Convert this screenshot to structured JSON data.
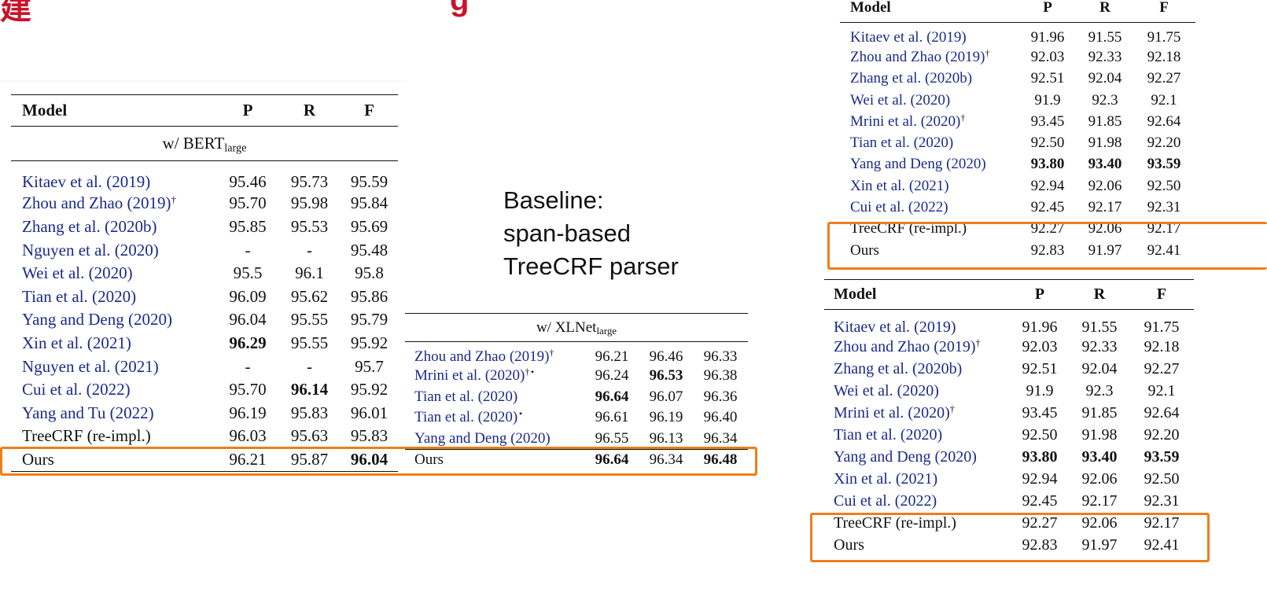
{
  "title_fragment": {
    "left": "建",
    "right": "g"
  },
  "baseline_text": [
    "Baseline:",
    "span-based",
    "TreeCRF parser"
  ],
  "headers": {
    "model": "Model",
    "p": "P",
    "r": "R",
    "f": "F"
  },
  "bert_table": {
    "section": {
      "prefix": "w/ BERT",
      "sub": "large"
    },
    "rows": [
      {
        "pre": "Kitaev et al. (",
        "year": "2019",
        "post": ")",
        "sup": "",
        "p": "95.46",
        "r": "95.73",
        "f": "95.59"
      },
      {
        "pre": "Zhou and Zhao (",
        "year": "2019",
        "post": ")",
        "sup": "†",
        "p": "95.70",
        "r": "95.98",
        "f": "95.84"
      },
      {
        "pre": "Zhang et al. (",
        "year": "2020b",
        "post": ")",
        "sup": "",
        "p": "95.85",
        "r": "95.53",
        "f": "95.69"
      },
      {
        "pre": "Nguyen et al. (",
        "year": "2020",
        "post": ")",
        "sup": "",
        "p": "-",
        "r": "-",
        "f": "95.48"
      },
      {
        "pre": "Wei et al. (",
        "year": "2020",
        "post": ")",
        "sup": "",
        "p": "95.5",
        "r": "96.1",
        "f": "95.8"
      },
      {
        "pre": "Tian et al. (",
        "year": "2020",
        "post": ")",
        "sup": "",
        "p": "96.09",
        "r": "95.62",
        "f": "95.86"
      },
      {
        "pre": "Yang and Deng (",
        "year": "2020",
        "post": ")",
        "sup": "",
        "p": "96.04",
        "r": "95.55",
        "f": "95.79"
      },
      {
        "pre": "Xin et al. (",
        "year": "2021",
        "post": ")",
        "sup": "",
        "p": "96.29",
        "r": "95.55",
        "f": "95.92",
        "bold": [
          "p"
        ]
      },
      {
        "pre": "Nguyen et al. (",
        "year": "2021",
        "post": ")",
        "sup": "",
        "p": "-",
        "r": "-",
        "f": "95.7"
      },
      {
        "pre": "Cui et al. (",
        "year": "2022",
        "post": ")",
        "sup": "",
        "p": "95.70",
        "r": "96.14",
        "f": "95.92",
        "bold": [
          "r"
        ]
      },
      {
        "pre": "Yang and Tu (",
        "year": "2022",
        "post": ")",
        "sup": "",
        "p": "96.19",
        "r": "95.83",
        "f": "96.01"
      },
      {
        "plain": "TreeCRF (re-impl.)",
        "p": "96.03",
        "r": "95.63",
        "f": "95.83"
      },
      {
        "plain": "Ours",
        "p": "96.21",
        "r": "95.87",
        "f": "96.04",
        "bold": [
          "f"
        ]
      }
    ]
  },
  "xlnet_table": {
    "section": {
      "prefix": "w/ XLNet",
      "sub": "large"
    },
    "rows": [
      {
        "pre": "Zhou and Zhao (",
        "year": "2019",
        "post": ")",
        "sup": "†",
        "p": "96.21",
        "r": "96.46",
        "f": "96.33"
      },
      {
        "pre": "Mrini et al. (",
        "year": "2020",
        "post": ")",
        "sup": "†⋆",
        "p": "96.24",
        "r": "96.53",
        "f": "96.38",
        "bold": [
          "r"
        ]
      },
      {
        "pre": "Tian et al. (",
        "year": "2020",
        "post": ")",
        "sup": "",
        "p": "96.64",
        "r": "96.07",
        "f": "96.36",
        "bold": [
          "p"
        ]
      },
      {
        "pre": "Tian et al. (",
        "year": "2020",
        "post": ")",
        "sup": "⋆",
        "p": "96.61",
        "r": "96.19",
        "f": "96.40"
      },
      {
        "pre": "Yang and Deng (",
        "year": "2020",
        "post": ")",
        "sup": "",
        "p": "96.55",
        "r": "96.13",
        "f": "96.34"
      },
      {
        "plain": "Ours",
        "p": "96.64",
        "r": "96.34",
        "f": "96.48",
        "bold": [
          "p",
          "f"
        ]
      }
    ]
  },
  "ctb_table": {
    "rows": [
      {
        "pre": "Kitaev et al. (",
        "year": "2019",
        "post": ")",
        "sup": "",
        "p": "91.96",
        "r": "91.55",
        "f": "91.75"
      },
      {
        "pre": "Zhou and Zhao (",
        "year": "2019",
        "post": ")",
        "sup": "†",
        "p": "92.03",
        "r": "92.33",
        "f": "92.18"
      },
      {
        "pre": "Zhang et al. (",
        "year": "2020b",
        "post": ")",
        "sup": "",
        "p": "92.51",
        "r": "92.04",
        "f": "92.27"
      },
      {
        "pre": "Wei et al. (",
        "year": "2020",
        "post": ")",
        "sup": "",
        "p": "91.9",
        "r": "92.3",
        "f": "92.1"
      },
      {
        "pre": "Mrini et al. (",
        "year": "2020",
        "post": ")",
        "sup": "†",
        "p": "93.45",
        "r": "91.85",
        "f": "92.64"
      },
      {
        "pre": "Tian et al. (",
        "year": "2020",
        "post": ")",
        "sup": "",
        "p": "92.50",
        "r": "91.98",
        "f": "92.20"
      },
      {
        "pre": "Yang and Deng (",
        "year": "2020",
        "post": ")",
        "sup": "",
        "p": "93.80",
        "r": "93.40",
        "f": "93.59",
        "bold": [
          "p",
          "r",
          "f"
        ]
      },
      {
        "pre": "Xin et al. (",
        "year": "2021",
        "post": ")",
        "sup": "",
        "p": "92.94",
        "r": "92.06",
        "f": "92.50"
      },
      {
        "pre": "Cui et al. (",
        "year": "2022",
        "post": ")",
        "sup": "",
        "p": "92.45",
        "r": "92.17",
        "f": "92.31"
      },
      {
        "plain": "TreeCRF (re-impl.)",
        "p": "92.27",
        "r": "92.06",
        "f": "92.17"
      },
      {
        "plain": "Ours",
        "p": "92.83",
        "r": "91.97",
        "f": "92.41"
      }
    ]
  },
  "colors": {
    "highlight_box": "#ef7d1a",
    "citation": "#1a2a8c",
    "title": "#c8142b"
  }
}
